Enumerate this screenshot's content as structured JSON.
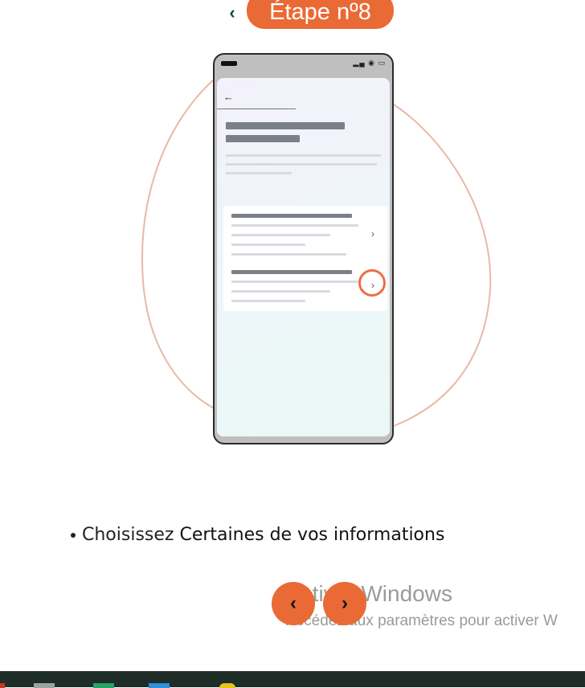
{
  "header": {
    "back_icon": "chevron-left-icon",
    "step_label": "Étape nº8",
    "accent_color": "#ea6a35"
  },
  "instruction": {
    "prefix": "Choisissez",
    "highlight": "Certaines de vos informations"
  },
  "navigation": {
    "prev_icon": "chevron-left-icon",
    "next_icon": "chevron-right-icon"
  },
  "watermark": {
    "title": "Activer Windows",
    "subtitle": "Accédez aux paramètres pour activer W"
  }
}
